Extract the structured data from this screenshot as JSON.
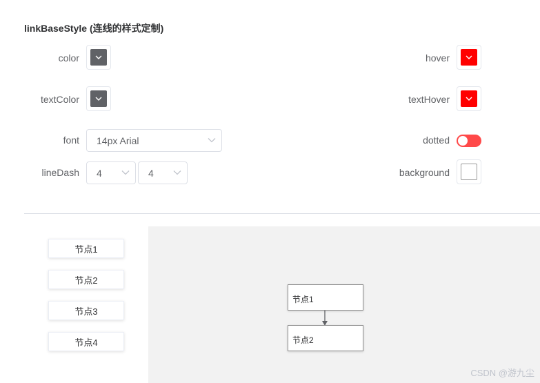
{
  "section_title": "linkBaseStyle (连线的样式定制)",
  "fields": {
    "color": {
      "label": "color",
      "value_color": "#606266"
    },
    "hover": {
      "label": "hover",
      "value_color": "#ff0000"
    },
    "textColor": {
      "label": "textColor",
      "value_color": "#606266"
    },
    "textHover": {
      "label": "textHover",
      "value_color": "#ff0000"
    },
    "font": {
      "label": "font",
      "value": "14px Arial"
    },
    "dotted": {
      "label": "dotted",
      "on": true,
      "active_color": "#ff4949"
    },
    "lineDash": {
      "label": "lineDash",
      "values": [
        "4",
        "4"
      ]
    },
    "background": {
      "label": "background",
      "value_color": ""
    }
  },
  "palette": [
    "节点1",
    "节点2",
    "节点3",
    "节点4"
  ],
  "canvas": {
    "background": "#f2f2f2",
    "nodes": [
      "节点1",
      "节点2"
    ],
    "links": [
      {
        "from": "节点1",
        "to": "节点2"
      }
    ]
  },
  "watermark": "CSDN @游九尘"
}
